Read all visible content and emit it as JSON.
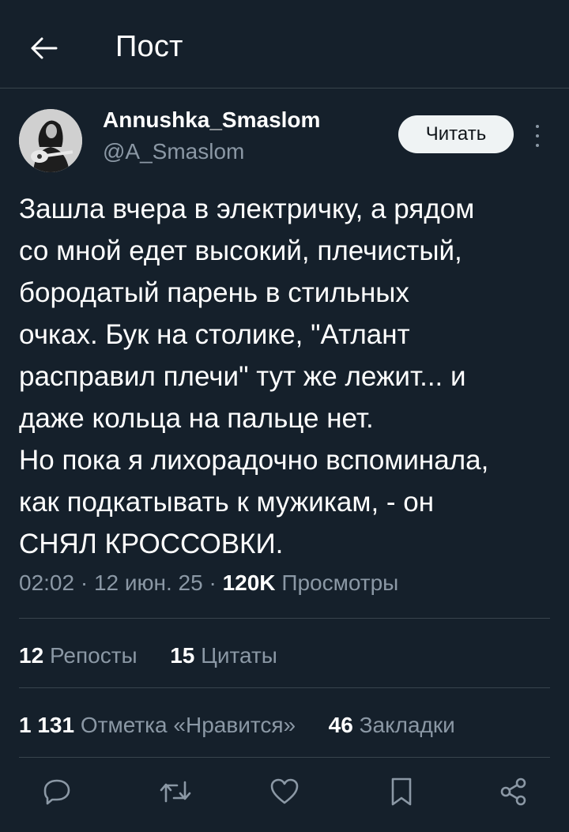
{
  "header": {
    "title": "Пост"
  },
  "author": {
    "display_name": "Annushka_Smaslom",
    "handle": "@A_Smaslom",
    "follow_label": "Читать"
  },
  "tweet": {
    "text": "Зашла вчера в электричку, а рядом\nсо мной едет высокий, плечистый,\nбородатый парень в стильных\nочках. Бук на столике, \"Атлант\nраспра­вил плечи\" тут же лежит... и\nдаже кольца на пальце нет.\nНо пока я лихорадочно вспоминала,\nкак подкатывать к мужикам, - он\nСНЯЛ КРОССОВКИ."
  },
  "meta": {
    "time": "02:02",
    "date": "12 июн. 25",
    "views_count": "120K",
    "views_label": "Просмотры"
  },
  "stats": {
    "reposts_count": "12",
    "reposts_label": "Репосты",
    "quotes_count": "15",
    "quotes_label": "Цитаты",
    "likes_count": "1 131",
    "likes_label": "Отметка «Нравится»",
    "bookmarks_count": "46",
    "bookmarks_label": "Закладки"
  },
  "icons": {
    "back": "arrow-left-icon",
    "reply": "reply-icon",
    "repost": "repost-icon",
    "like": "heart-icon",
    "bookmark": "bookmark-icon",
    "share": "share-icon",
    "more": "more-vertical-icon"
  },
  "colors": {
    "background": "#15202b",
    "secondary_text": "#8b98a5",
    "divider": "#38444d",
    "follow_button_bg": "#eff3f4"
  }
}
